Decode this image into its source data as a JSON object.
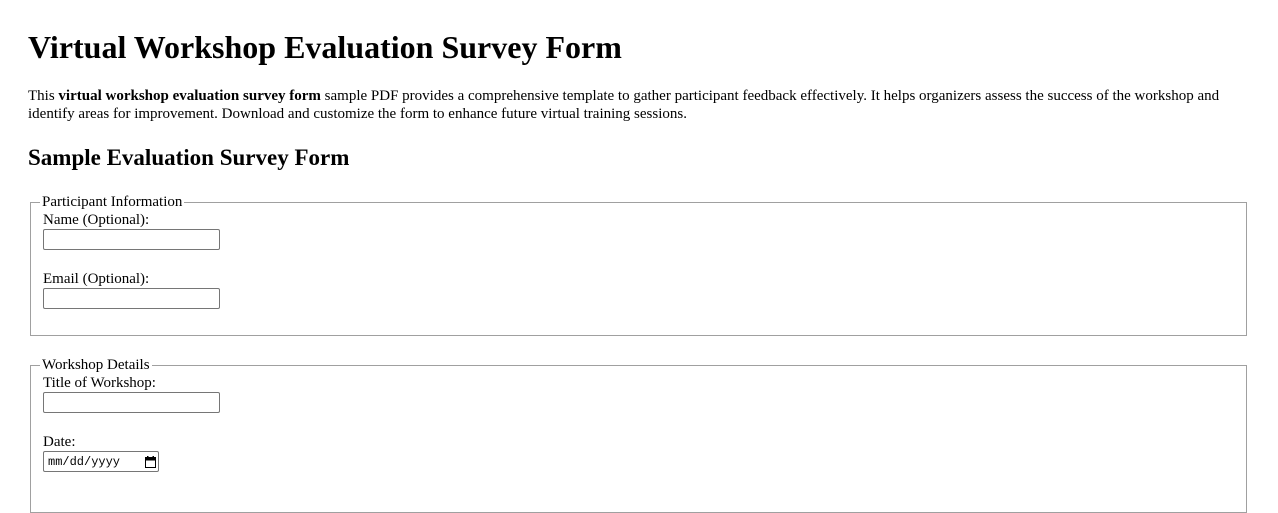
{
  "page": {
    "title": "Virtual Workshop Evaluation Survey Form",
    "intro_before": "This ",
    "intro_bold": "virtual workshop evaluation survey form",
    "intro_after": " sample PDF provides a comprehensive template to gather participant feedback effectively. It helps organizers assess the success of the workshop and identify areas for improvement. Download and customize the form to enhance future virtual training sessions.",
    "section_title": "Sample Evaluation Survey Form"
  },
  "participant": {
    "legend": "Participant Information",
    "name_label": "Name (Optional):",
    "name_value": "",
    "email_label": "Email (Optional):",
    "email_value": ""
  },
  "workshop": {
    "legend": "Workshop Details",
    "title_label": "Title of Workshop:",
    "title_value": "",
    "date_label": "Date:",
    "date_placeholder": "mm/dd/yyyy",
    "date_icon": "calendar-icon"
  }
}
